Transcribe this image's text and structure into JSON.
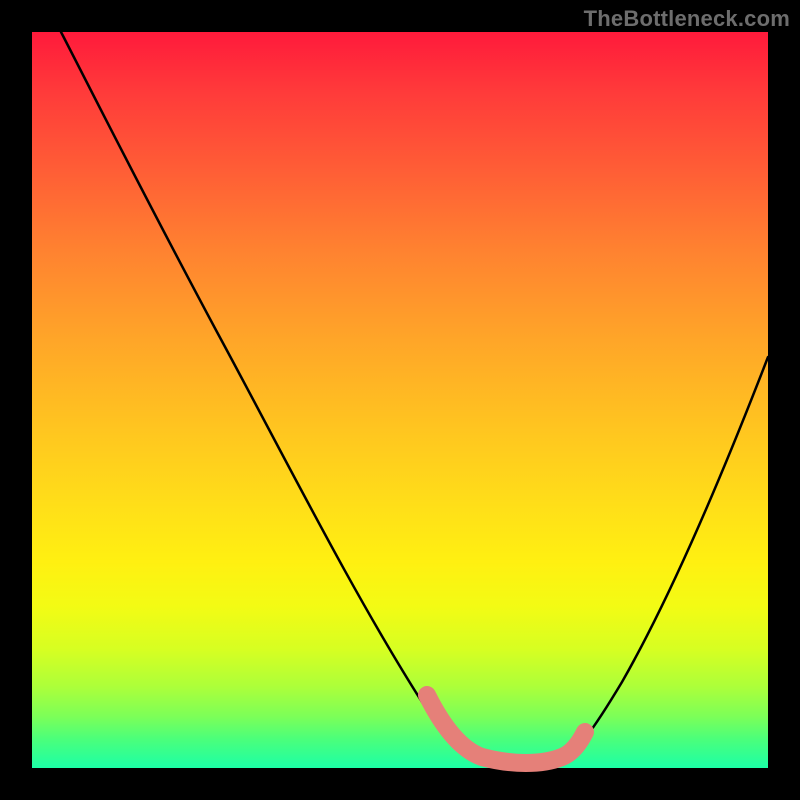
{
  "watermark": "TheBottleneck.com",
  "chart_data": {
    "type": "line",
    "title": "",
    "xlabel": "",
    "ylabel": "",
    "xlim": [
      0,
      100
    ],
    "ylim": [
      0,
      100
    ],
    "grid": false,
    "legend": false,
    "series": [
      {
        "name": "bottleneck-curve",
        "color": "#000000",
        "x": [
          4,
          10,
          20,
          30,
          40,
          50,
          55,
          58,
          60,
          65,
          70,
          72,
          74,
          78,
          84,
          92,
          100
        ],
        "values": [
          100,
          89,
          72,
          55,
          38,
          21,
          12,
          6,
          3,
          1,
          1,
          1,
          2,
          7,
          17,
          36,
          60
        ]
      },
      {
        "name": "highlight-band",
        "color": "#e58079",
        "x": [
          55,
          58,
          60,
          65,
          70,
          72,
          74
        ],
        "values": [
          12,
          6,
          3,
          1,
          1,
          1,
          2
        ]
      }
    ],
    "background_gradient": {
      "top": "#ff1a3b",
      "mid": "#ffe018",
      "bottom": "#1cffa6"
    }
  }
}
